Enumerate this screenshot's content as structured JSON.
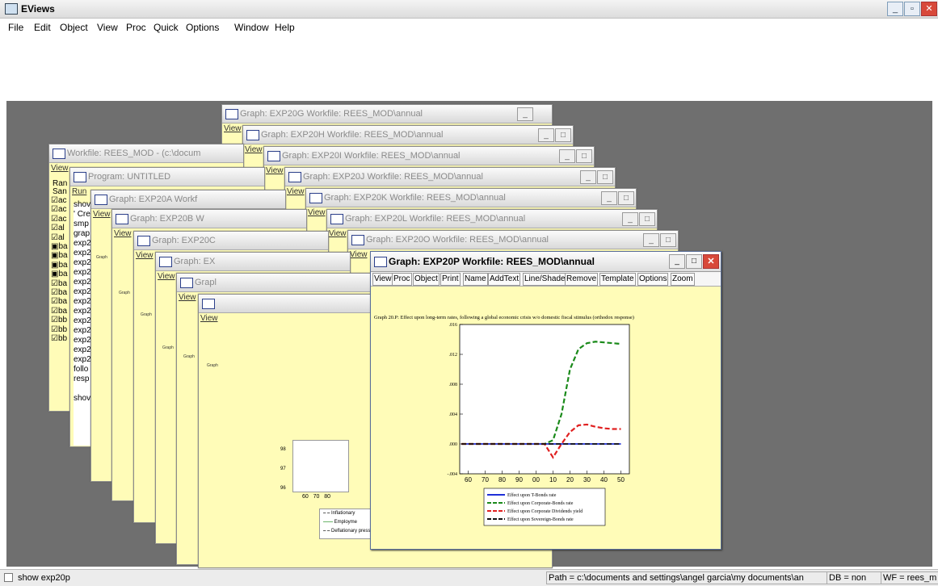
{
  "app": {
    "title": "EViews"
  },
  "menu": [
    "File",
    "Edit",
    "Object",
    "View",
    "Proc",
    "Quick",
    "Options",
    "Window",
    "Help"
  ],
  "window_controls": {
    "minimize": "_",
    "restore": "▫",
    "close": "✕"
  },
  "windows": {
    "exp20g_title": "Graph: EXP20G   Workfile: REES_MOD\\annual",
    "exp20h_title": "Graph: EXP20H   Workfile: REES_MOD\\annual",
    "exp20i_title": "Graph: EXP20I   Workfile: REES_MOD\\annual",
    "exp20j_title": "Graph: EXP20J   Workfile: REES_MOD\\annual",
    "exp20k_title": "Graph: EXP20K   Workfile: REES_MOD\\annual",
    "exp20l_title": "Graph: EXP20L   Workfile: REES_MOD\\annual",
    "exp20o_title": "Graph: EXP20O   Workfile: REES_MOD\\annual",
    "workfile_title": "Workfile: REES_MOD - (c:\\docum",
    "program_title": "Program: UNTITLED",
    "exp20a_title": "Graph: EXP20A   Workf",
    "exp20b_title": "Graph: EXP20B   W",
    "exp20c_title": "Graph: EXP20C",
    "exp20d_title": "Graph: EX",
    "exp20e_title": "Grapl",
    "exp20f_title": "",
    "view_label": "View",
    "run_label": "Run",
    "workfile_head": [
      "Ran",
      "San"
    ],
    "workfile_items": [
      "ac",
      "ac",
      "ac",
      "al",
      "al",
      "ba",
      "ba",
      "ba",
      "ba",
      "ba",
      "ba",
      "ba",
      "ba",
      "bb",
      "bb",
      "bb"
    ],
    "program_lines": [
      "shov",
      "",
      "' Cre",
      "smp",
      "grap",
      "exp2",
      "exp2",
      "exp2",
      "exp2",
      "exp2",
      "exp2",
      "exp2",
      "exp2",
      "exp2",
      "exp2",
      "exp2",
      "exp2",
      "exp2",
      "follo",
      "resp",
      "",
      "shov"
    ],
    "ghost_ticks": [
      "98",
      "97",
      "96",
      "60",
      "70",
      "80"
    ],
    "ghost_legend": [
      "Inflationary",
      "Employme",
      "Deflationary pressure threshold"
    ],
    "tiny_graph": "Graph"
  },
  "active_window": {
    "title": "Graph: EXP20P   Workfile: REES_MOD\\annual",
    "toolbar": [
      "View",
      "Proc",
      "Object",
      "Print",
      "Name",
      "AddText",
      "Line/Shade",
      "Remove",
      "Template",
      "Options",
      "Zoom"
    ]
  },
  "chart_data": {
    "type": "line",
    "title": "Graph 20.P: Effect upon long-term rates, following a global economic crisis w/o domestic fiscal stimulus (orthodox response)",
    "x": [
      1,
      5,
      10,
      15,
      20,
      25,
      30,
      35,
      40,
      45,
      50,
      55,
      60,
      65,
      70,
      75,
      80,
      85,
      90,
      95
    ],
    "xticks": [
      "60",
      "70",
      "80",
      "90",
      "00",
      "10",
      "20",
      "30",
      "40",
      "50"
    ],
    "ylim": [
      -0.004,
      0.016
    ],
    "yticks": [
      ".016",
      ".012",
      ".008",
      ".004",
      ".000",
      "-.004"
    ],
    "series": [
      {
        "name": "Effect upon T-Bonds rate",
        "color": "#1f2fd8",
        "dash": "solid",
        "values": [
          0,
          0,
          0,
          0,
          0,
          0,
          0,
          0,
          0,
          0,
          0,
          0,
          0,
          0,
          0,
          0,
          0,
          0,
          0,
          0
        ]
      },
      {
        "name": "Effect upon Corporate-Bonds rate",
        "color": "#1a8a1a",
        "dash": "dashed",
        "values": [
          0,
          0,
          0,
          0,
          0,
          0,
          0,
          0,
          0,
          0,
          0,
          0.0005,
          0.004,
          0.01,
          0.0127,
          0.0135,
          0.0137,
          0.0136,
          0.0135,
          0.0134
        ]
      },
      {
        "name": "Effect upon Corporate Dividends yield",
        "color": "#e02020",
        "dash": "dashed",
        "values": [
          0,
          0,
          0,
          0,
          0,
          0,
          0,
          0,
          0,
          0,
          0,
          -0.0018,
          0,
          0.0016,
          0.0025,
          0.0026,
          0.0023,
          0.0021,
          0.002,
          0.002
        ]
      },
      {
        "name": "Effect upon Sovereign-Bonds rate",
        "color": "#111111",
        "dash": "dashed",
        "values": [
          0,
          0,
          0,
          0,
          0,
          0,
          0,
          0,
          0,
          0,
          0,
          0,
          0,
          0,
          0,
          0,
          0,
          0,
          0,
          0
        ]
      }
    ],
    "grid": false,
    "legend": "bottom"
  },
  "status": {
    "command": "show exp20p",
    "path": "Path = c:\\documents and settings\\angel garcia\\my documents\\an",
    "db": "DB = non",
    "wf": "WF = rees_m"
  }
}
